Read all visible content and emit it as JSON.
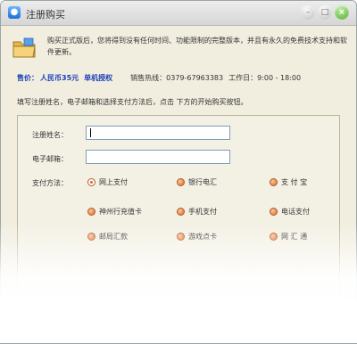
{
  "window": {
    "title": "注册购买"
  },
  "intro_text": "购买正式版后，您将得到没有任何时间、功能限制的完整版本，并且有永久的免费技术支持和软件更新。",
  "price": {
    "label": "售价：",
    "value": "人民币35元",
    "auth": "单机授权"
  },
  "contact": {
    "hotline": "销售热线：0379-67963383",
    "hours": "工作日：9:00 - 18:00"
  },
  "instruction": "填写注册姓名，电子邮箱和选择支付方法后，点击 下方的开始购买按钮。",
  "form": {
    "name_label": "注册姓名：",
    "name_value": "",
    "email_label": "电子邮箱：",
    "email_value": "",
    "payment_label": "支付方法：",
    "payment_options": [
      "网上支付",
      "银行电汇",
      "支 付 宝",
      "神州行充值卡",
      "手机支付",
      "电话支付",
      "邮局汇款",
      "游戏点卡",
      "网 汇 通"
    ],
    "selected_payment": "网上支付"
  },
  "colors": {
    "accent": "#1a3fb8",
    "radio": "#d46a2a",
    "close_button": "#4caf2a"
  },
  "icons": {
    "title": "app-icon",
    "intro": "folder-icon"
  }
}
